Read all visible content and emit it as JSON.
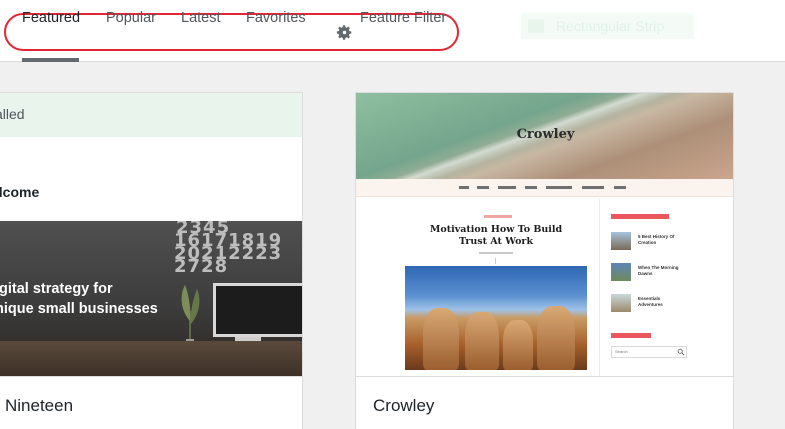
{
  "filter_bar": {
    "tabs": [
      {
        "label": "Featured",
        "current": true
      },
      {
        "label": "Popular",
        "current": false
      },
      {
        "label": "Latest",
        "current": false
      },
      {
        "label": "Favorites",
        "current": false
      }
    ],
    "feature_filter_label": "Feature Filter",
    "ghost_label": "Rectangular Strip",
    "highlight_color": "#e32636"
  },
  "themes": [
    {
      "name": "Nineteen",
      "installed_label": "alled",
      "preview": {
        "welcome": "elcome",
        "hero_line1": "gital strategy for",
        "hero_line2": "nique small businesses",
        "calendar_rows": [
          "2345",
          "16171819",
          "20212223",
          "2728"
        ]
      }
    },
    {
      "name": "Crowley",
      "preview": {
        "site_title": "Crowley",
        "post_title": "Motivation How To Build Trust At Work",
        "sidebar_posts": [
          "5 Best History Of Creation",
          "When The Morning Dawns",
          "Essentials Adventures"
        ],
        "search_placeholder": "Search"
      }
    }
  ]
}
